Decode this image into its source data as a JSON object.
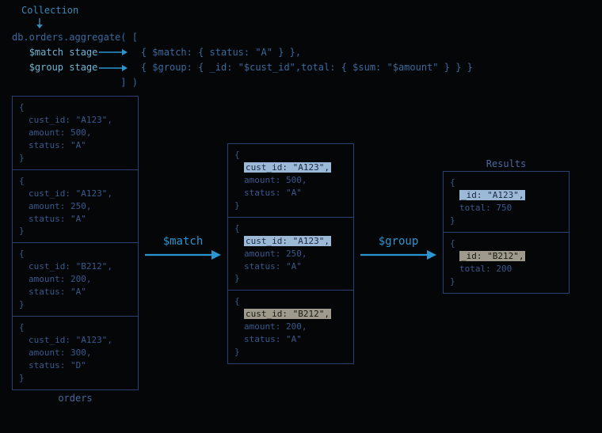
{
  "header": {
    "collection_label": "Collection",
    "code_line_1": "db.orders.aggregate( [",
    "match_stage_label": "$match stage",
    "match_code": "{ $match: { status: \"A\" } },",
    "group_stage_label": "$group stage",
    "group_code": "{ $group: { _id: \"$cust_id\",total: { $sum: \"$amount\" } } }",
    "code_line_end": "] )"
  },
  "arrows": {
    "match_op": "$match",
    "group_op": "$group"
  },
  "titles": {
    "orders": "orders",
    "results": "Results"
  },
  "orders": [
    {
      "cust_id": "cust_id: \"A123\",",
      "amount": "amount: 500,",
      "status": "status: \"A\""
    },
    {
      "cust_id": "cust_id: \"A123\",",
      "amount": "amount: 250,",
      "status": "status: \"A\""
    },
    {
      "cust_id": "cust_id: \"B212\",",
      "amount": "amount: 200,",
      "status": "status: \"A\""
    },
    {
      "cust_id": "cust_id: \"A123\",",
      "amount": "amount: 300,",
      "status": "status: \"D\""
    }
  ],
  "matched": [
    {
      "cust_id_hl": "cust_id: \"A123\",",
      "amount": "amount: 500,",
      "status": "status: \"A\"",
      "hl_class": "hl-a"
    },
    {
      "cust_id_hl": "cust_id: \"A123\",",
      "amount": "amount: 250,",
      "status": "status: \"A\"",
      "hl_class": "hl-a"
    },
    {
      "cust_id_hl": "cust_id: \"B212\",",
      "amount": "amount: 200,",
      "status": "status: \"A\"",
      "hl_class": "hl-b"
    }
  ],
  "results": [
    {
      "id_hl": "_id: \"A123\",",
      "total": "total: 750",
      "hl_class": "hl-a"
    },
    {
      "id_hl": "_id: \"B212\",",
      "total": "total: 200",
      "hl_class": "hl-b"
    }
  ]
}
